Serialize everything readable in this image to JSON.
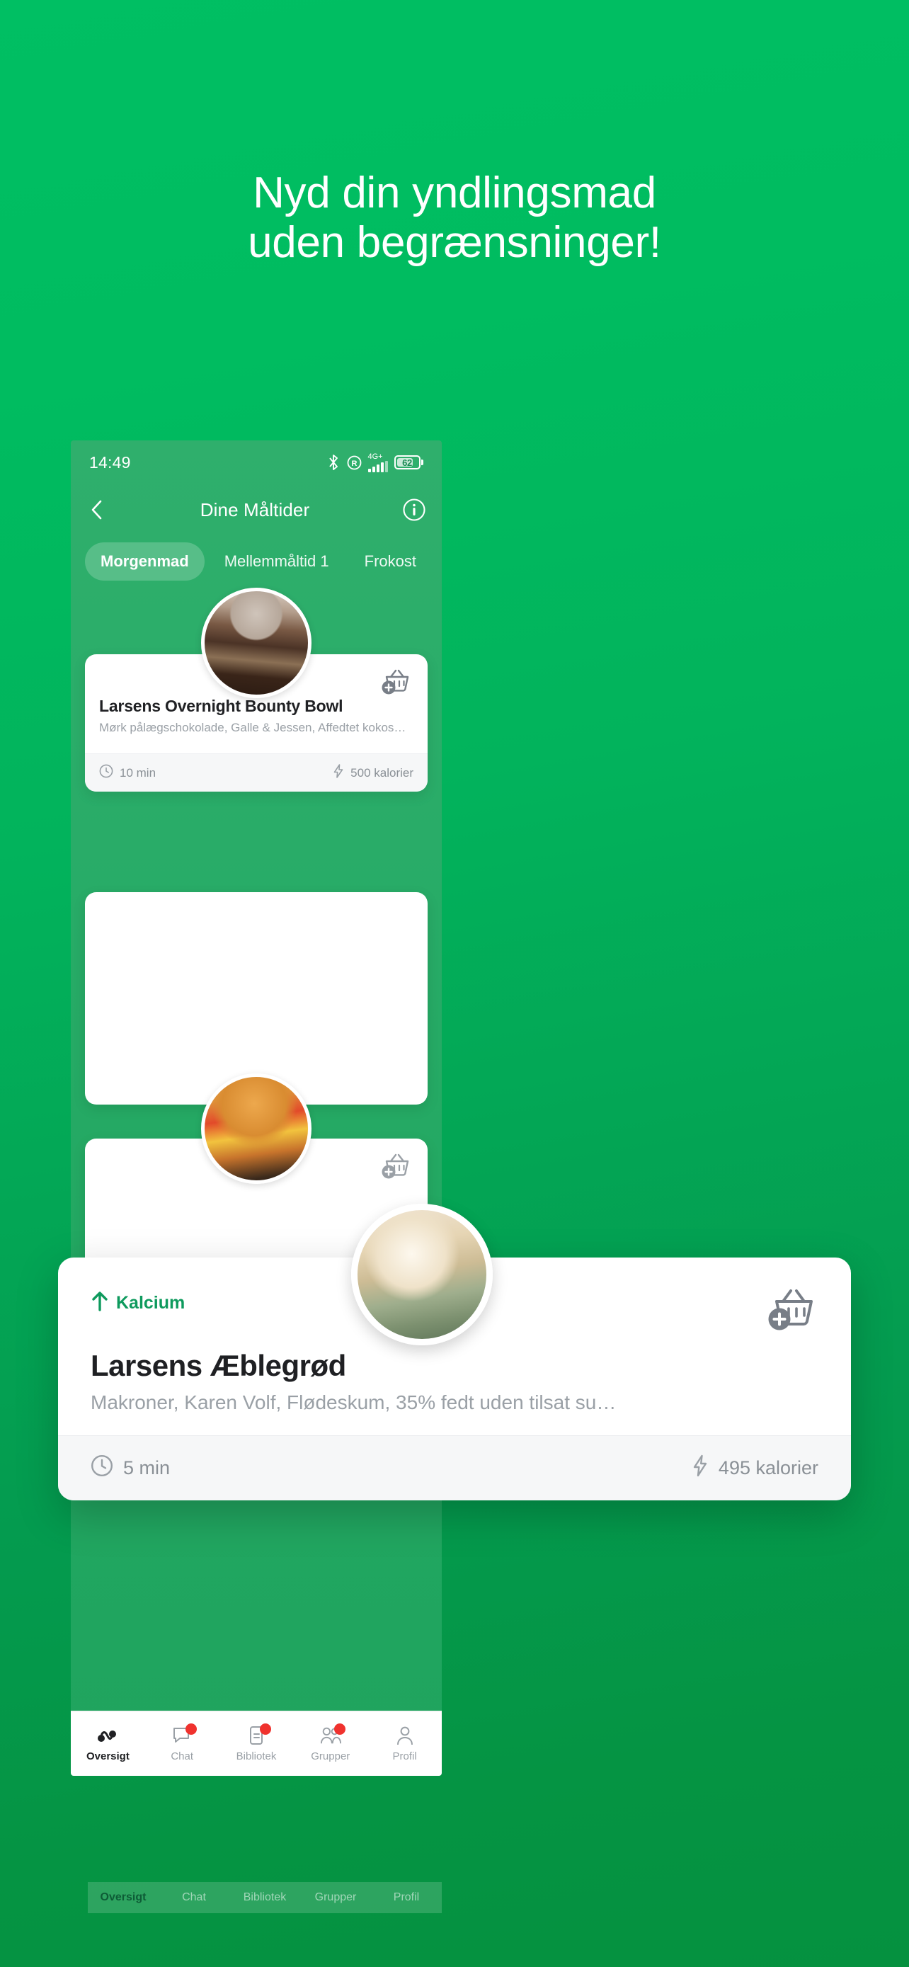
{
  "promo": {
    "headline_line1": "Nyd din yndlingsmad",
    "headline_line2": "uden begrænsninger!",
    "background_color": "#00BF63",
    "accent_color": "#0E9A5D"
  },
  "status_bar": {
    "time": "14:49",
    "network_label": "4G+",
    "battery_level": "62",
    "icons": [
      "bluetooth-icon",
      "roaming-icon",
      "signal-icon",
      "battery-icon"
    ]
  },
  "app_bar": {
    "back_label": "Tilbage",
    "title": "Dine Måltider",
    "info_label": "Info"
  },
  "tabs": [
    {
      "label": "Morgenmad",
      "active": true
    },
    {
      "label": "Mellemmåltid 1",
      "active": false
    },
    {
      "label": "Frokost",
      "active": false
    }
  ],
  "meals": [
    {
      "title": "Larsens Overnight Bounty Bowl",
      "description": "Mørk pålægschokolade, Galle & Jessen, Affedtet kokosm…",
      "time": "10 min",
      "calories": "500 kalorier",
      "add_label": "Tilføj til kurv"
    },
    {
      "badge": "Kalcium",
      "title": "Larsens Æblegrød",
      "description": "Makroner, Karen Volf, Flødeskum, 35% fedt uden tilsat su…",
      "time": "5 min",
      "calories": "495 kalorier",
      "add_label": "Tilføj til kurv"
    },
    {
      "title": "",
      "description": "",
      "time": "",
      "calories": "",
      "add_label": "Tilføj til kurv"
    }
  ],
  "bottom_nav": [
    {
      "label": "Oversigt",
      "icon": "activity-icon",
      "active": true,
      "badge": false
    },
    {
      "label": "Chat",
      "icon": "chat-icon",
      "active": false,
      "badge": true
    },
    {
      "label": "Bibliotek",
      "icon": "book-icon",
      "active": false,
      "badge": true
    },
    {
      "label": "Grupper",
      "icon": "people-icon",
      "active": false,
      "badge": true
    },
    {
      "label": "Profil",
      "icon": "person-icon",
      "active": false,
      "badge": false
    }
  ]
}
